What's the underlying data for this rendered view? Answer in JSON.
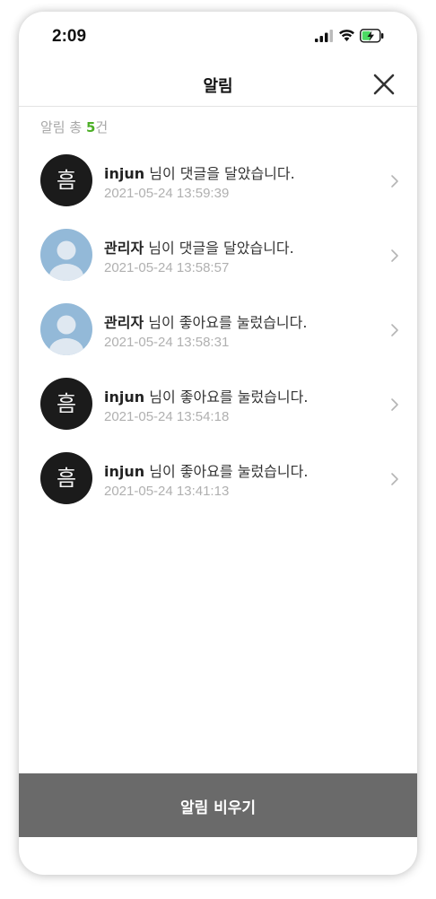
{
  "status_bar": {
    "time": "2:09"
  },
  "header": {
    "title": "알림"
  },
  "summary": {
    "prefix": "알림 총 ",
    "count": "5",
    "suffix": "건"
  },
  "notifications": [
    {
      "name": "injun",
      "message": " 님이 댓글을 달았습니다.",
      "time": "2021-05-24 13:59:39",
      "avatar": "logo",
      "avatar_glyph": "흠"
    },
    {
      "name": "관리자",
      "message": " 님이 댓글을 달았습니다.",
      "time": "2021-05-24 13:58:57",
      "avatar": "default-profile"
    },
    {
      "name": "관리자",
      "message": " 님이 좋아요를 눌렀습니다.",
      "time": "2021-05-24 13:58:31",
      "avatar": "default-profile"
    },
    {
      "name": "injun",
      "message": " 님이 좋아요를 눌렀습니다.",
      "time": "2021-05-24 13:54:18",
      "avatar": "logo",
      "avatar_glyph": "흠"
    },
    {
      "name": "injun",
      "message": " 님이 좋아요를 눌렀습니다.",
      "time": "2021-05-24 13:41:13",
      "avatar": "logo",
      "avatar_glyph": "흠"
    }
  ],
  "footer": {
    "clear_label": "알림 비우기"
  },
  "colors": {
    "count_accent": "#4caf26",
    "button_bg": "#6a6a6a",
    "avatar_default": "#93b9d8",
    "battery_green": "#4cd964"
  }
}
